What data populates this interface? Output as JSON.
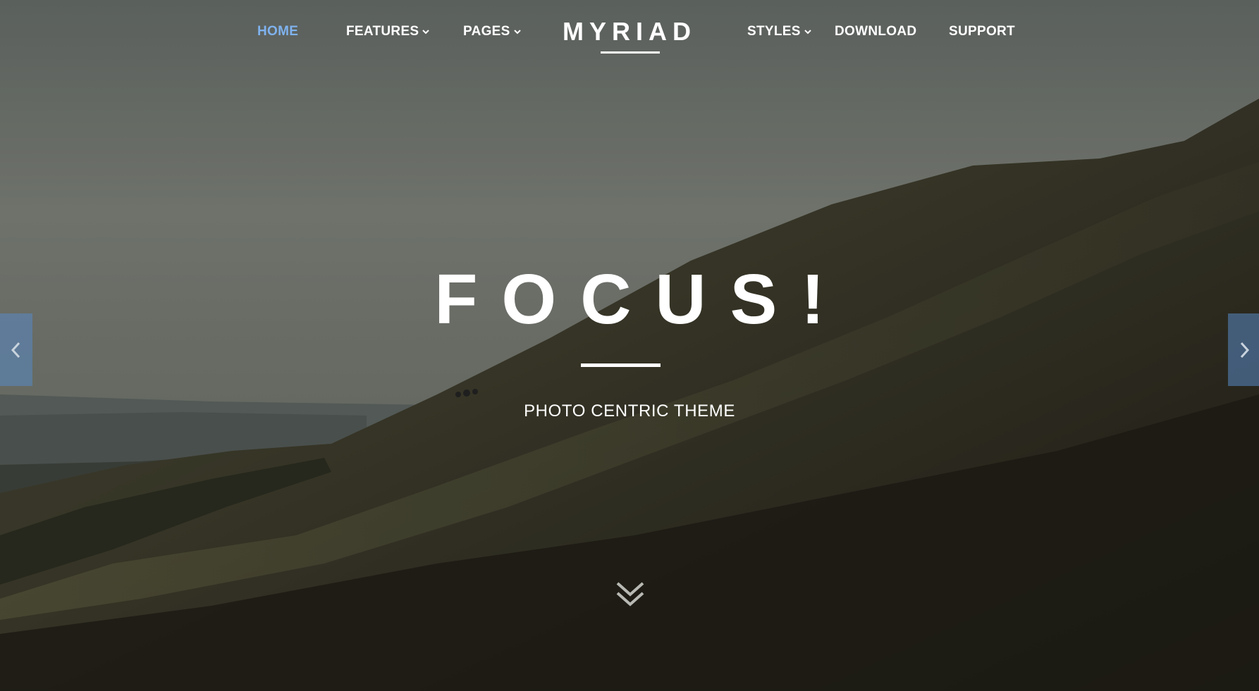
{
  "nav": {
    "items_left": [
      {
        "label": "HOME",
        "active": true,
        "dropdown": false
      },
      {
        "label": "FEATURES",
        "active": false,
        "dropdown": true
      },
      {
        "label": "PAGES",
        "active": false,
        "dropdown": true
      }
    ],
    "logo": "MYRIAD",
    "items_right": [
      {
        "label": "STYLES",
        "active": false,
        "dropdown": true
      },
      {
        "label": "DOWNLOAD",
        "active": false,
        "dropdown": false
      },
      {
        "label": "SUPPORT",
        "active": false,
        "dropdown": false
      }
    ]
  },
  "hero": {
    "title": "FOCUS!",
    "subtitle": "PHOTO CENTRIC THEME"
  },
  "controls": {
    "prev_icon": "chevron-left-icon",
    "next_icon": "chevron-right-icon",
    "scroll_icon": "double-chevron-down-icon"
  },
  "colors": {
    "active_nav": "#7fb2ee",
    "text": "#ffffff",
    "arrow_bg": "#5888c4"
  }
}
